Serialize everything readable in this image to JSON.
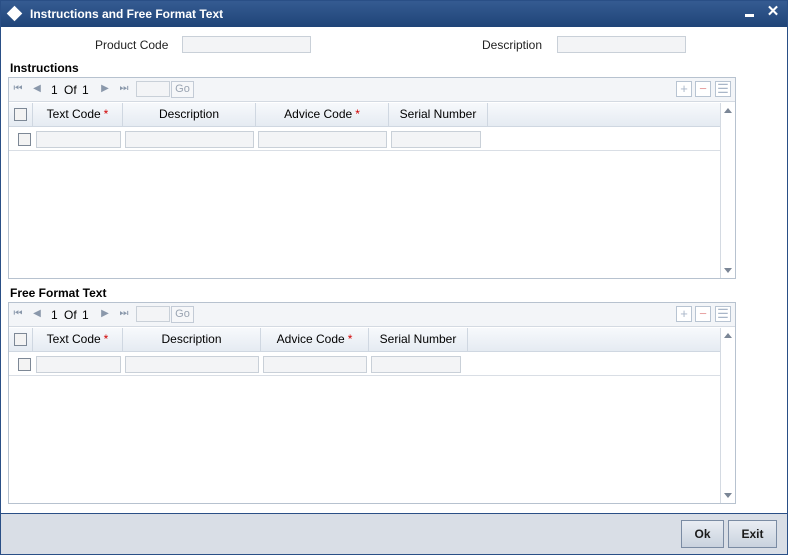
{
  "window": {
    "title": "Instructions and Free Format Text",
    "minimize_icon": "minimize-icon",
    "close_symbol": "✕"
  },
  "form": {
    "product_code_label": "Product Code",
    "product_code_value": "",
    "description_label": "Description",
    "description_value": ""
  },
  "instructions": {
    "title": "Instructions",
    "pager": {
      "page": "1",
      "of_label": "Of",
      "total": "1",
      "go_label": "Go",
      "page_input": ""
    },
    "columns": [
      "Text Code",
      "Description",
      "Advice Code",
      "Serial Number"
    ],
    "required_mark": "*",
    "rows": [
      {
        "text_code": "",
        "description": "",
        "advice_code": "",
        "serial_number": ""
      }
    ]
  },
  "free_format": {
    "title": "Free Format Text",
    "pager": {
      "page": "1",
      "of_label": "Of",
      "total": "1",
      "go_label": "Go",
      "page_input": ""
    },
    "columns": [
      "Text Code",
      "Description",
      "Advice Code",
      "Serial Number"
    ],
    "required_mark": "*",
    "rows": [
      {
        "text_code": "",
        "description": "",
        "advice_code": "",
        "serial_number": ""
      }
    ]
  },
  "footer": {
    "ok_label": "Ok",
    "exit_label": "Exit"
  },
  "colors": {
    "titlebar": "#1f4478",
    "required": "#d00000",
    "footer": "#d9dee6"
  }
}
